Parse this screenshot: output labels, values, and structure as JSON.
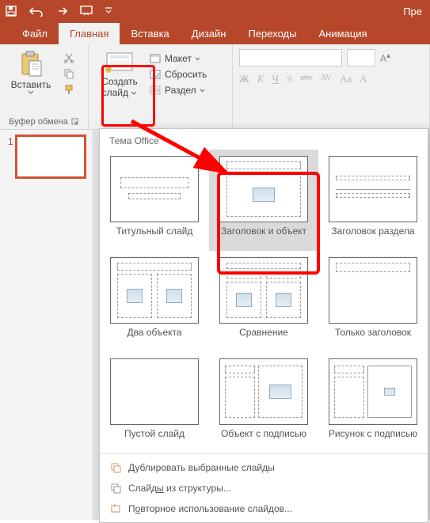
{
  "app": {
    "title_fragment": "Пре"
  },
  "tabs": {
    "file": "Файл",
    "home": "Главная",
    "insert": "Вставка",
    "design": "Дизайн",
    "transitions": "Переходы",
    "animations": "Анимация"
  },
  "ribbon": {
    "clipboard": {
      "paste": "Вставить",
      "group_label": "Буфер обмена"
    },
    "slides": {
      "new_slide_line1": "Создать",
      "new_slide_line2": "слайд",
      "layout": "Макет",
      "reset": "Сбросить",
      "section": "Раздел"
    },
    "font": {
      "bold": "Ж",
      "italic": "К",
      "underline": "Ч",
      "shadow": "S",
      "strike": "abc",
      "spacing": "AV",
      "case": "Aa",
      "clear": "A"
    }
  },
  "thumb": {
    "num": "1"
  },
  "gallery": {
    "header": "Тема Office",
    "layouts": [
      "Титульный слайд",
      "Заголовок и объект",
      "Заголовок раздела",
      "Два объекта",
      "Сравнение",
      "Только заголовок",
      "Пустой слайд",
      "Объект с подписью",
      "Рисунок с подписью"
    ],
    "footer": {
      "duplicate": "Дублировать выбранные слайды",
      "outline_pre": "Слайд",
      "outline_u": "ы",
      "outline_post": " из структуры...",
      "reuse_pre": "П",
      "reuse_u": "о",
      "reuse_post": "вторное использование слайдов..."
    }
  },
  "colors": {
    "brand": "#B7472A",
    "highlight": "#FF0000"
  }
}
